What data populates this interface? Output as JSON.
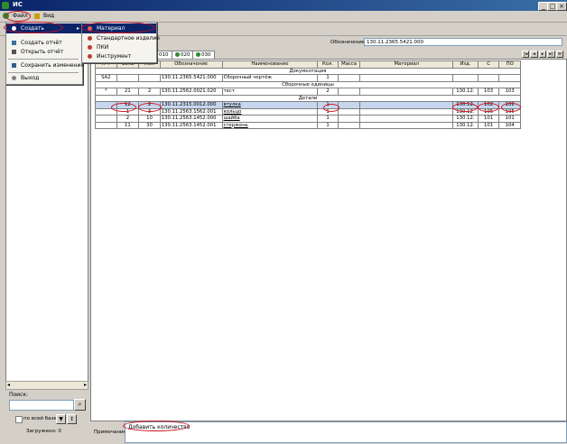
{
  "window": {
    "title": "ИС"
  },
  "menubar": {
    "items": [
      "Файл",
      "Вид"
    ]
  },
  "file_menu": {
    "items": [
      "Создать",
      "Создать отчёт",
      "Открыть отчёт",
      "Сохранить изменения",
      "Выход"
    ]
  },
  "create_submenu": {
    "items": [
      "Материал",
      "Стандартное изделие",
      "ПКИ",
      "Инструмент"
    ]
  },
  "designation": {
    "label": "Обозначение",
    "value": "130.11.2365.5421.000"
  },
  "tabs": [
    "010",
    "020",
    "030"
  ],
  "table": {
    "columns": [
      "К-т",
      "Зона",
      "Поз.",
      "Обозначение",
      "Наименование",
      "Кол.",
      "Масса",
      "Материал",
      "Изд.",
      "С",
      "ПО"
    ],
    "sections": {
      "docs": "Документация",
      "assemblies": "Сборочные единицы",
      "details": "Детали"
    },
    "rows_docs": [
      {
        "kt": "SA2",
        "zone": "",
        "pos": "",
        "designation": "130.11.2365.5421.000",
        "name": "Сборочный чертёж",
        "qty": "1",
        "mass": "",
        "material": "",
        "izd": "",
        "c": "",
        "po": ""
      }
    ],
    "rows_asm": [
      {
        "kt": "*",
        "zone": "21",
        "pos": "2",
        "designation": "130.11.2562.0021.020",
        "name": "тест",
        "qty": "2",
        "mass": "",
        "material": "",
        "izd": "130.12.",
        "c": "103",
        "po": "103"
      }
    ],
    "rows_det": [
      {
        "kt": "",
        "zone": "12",
        "pos": "2",
        "designation": "130.11.2315.0012.000",
        "name": "втулка",
        "qty": "1",
        "mass": "",
        "material": "",
        "izd": "130.12.",
        "c": "102",
        "po": "102"
      },
      {
        "kt": "",
        "zone": "1",
        "pos": "3",
        "designation": "130.11.2563.1562.001",
        "name": "кольцо",
        "qty": "1",
        "mass": "",
        "material": "",
        "izd": "130.12.",
        "c": "105",
        "po": "105"
      },
      {
        "kt": "",
        "zone": "2",
        "pos": "10",
        "designation": "130.11.2563.1452.000",
        "name": "шайба",
        "qty": "1",
        "mass": "",
        "material": "",
        "izd": "130.12.",
        "c": "101",
        "po": "101"
      },
      {
        "kt": "",
        "zone": "11",
        "pos": "30",
        "designation": "130.11.2563.1452.001",
        "name": "стержень",
        "qty": "1",
        "mass": "",
        "material": "",
        "izd": "130.12.",
        "c": "101",
        "po": "104"
      }
    ]
  },
  "left_panel": {
    "search_label": "Поиск:",
    "search_value": "",
    "all_bases_label": "по всей базе",
    "loaded_label": "Загружено: 0"
  },
  "notes": {
    "label": "Примечание:",
    "value": "Добавить количество"
  }
}
